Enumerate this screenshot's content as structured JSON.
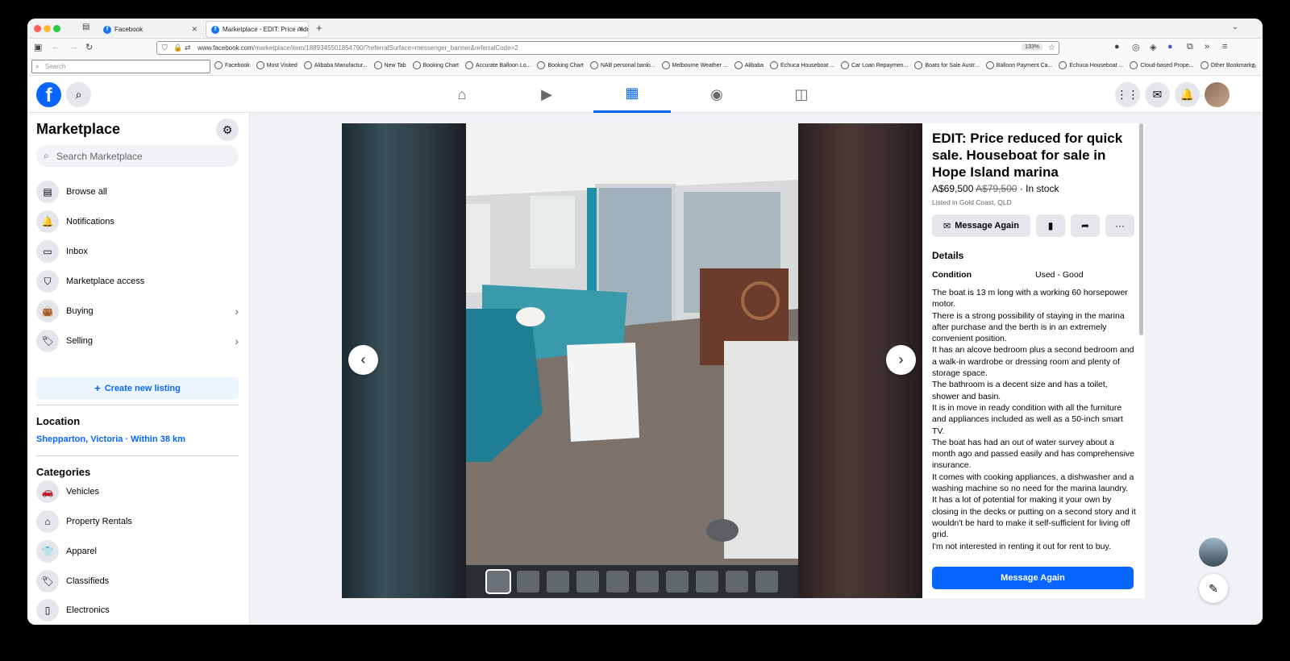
{
  "browser": {
    "tabs": [
      {
        "label": "Facebook"
      },
      {
        "label": "Marketplace - EDIT: Price reduc"
      }
    ],
    "url_host": "www.facebook.com",
    "url_path": "/marketplace/item/1889345501854790/?referralSurface=messenger_banner&referralCode=2",
    "zoom": "133%",
    "search_placeholder": "Search",
    "bookmarks": [
      "Facebook",
      "Most Visited",
      "Alibaba Manufactur...",
      "New Tab",
      "Booking Chart",
      "Accurate Balloon Lo...",
      "Booking Chart",
      "NAB personal banki...",
      "Melbourne Weather ...",
      "Alibaba",
      "Echuca Houseboat ...",
      "Car Loan Repaymen...",
      "Boats for Sale Austr...",
      "Balloon Payment Ca...",
      "Echuca Houseboat ...",
      "Cloud-based Prope...",
      "Other Bookmarks"
    ]
  },
  "sidebar": {
    "title": "Marketplace",
    "search_placeholder": "Search Marketplace",
    "items": [
      {
        "label": "Browse all",
        "icon": "store-icon"
      },
      {
        "label": "Notifications",
        "icon": "bell-icon"
      },
      {
        "label": "Inbox",
        "icon": "inbox-icon"
      },
      {
        "label": "Marketplace access",
        "icon": "shield-icon"
      },
      {
        "label": "Buying",
        "icon": "bag-icon"
      },
      {
        "label": "Selling",
        "icon": "tag-icon"
      }
    ],
    "create_label": "Create new listing",
    "location_heading": "Location",
    "location_value": "Shepparton, Victoria · Within 38 km",
    "categories_heading": "Categories",
    "categories": [
      {
        "label": "Vehicles",
        "icon": "car-icon"
      },
      {
        "label": "Property Rentals",
        "icon": "house-icon"
      },
      {
        "label": "Apparel",
        "icon": "shirt-icon"
      },
      {
        "label": "Classifieds",
        "icon": "tags-icon"
      },
      {
        "label": "Electronics",
        "icon": "phone-icon"
      }
    ]
  },
  "listing": {
    "title": "EDIT: Price reduced for quick sale. Houseboat for sale in Hope Island marina",
    "price": "A$69,500",
    "old_price": "A$79,500",
    "stock": "· In stock",
    "listed": "Listed in Gold Coast, QLD",
    "message_label": "Message Again",
    "details_heading": "Details",
    "condition_label": "Condition",
    "condition_value": "Used - Good",
    "description": [
      "The boat is 13 m long with a working 60 horsepower motor.",
      "There is a strong possibility of staying in the marina after purchase and the berth is in an extremely convenient position.",
      "It has an alcove bedroom plus a second bedroom and a walk-in wardrobe or dressing room and plenty of storage space.",
      "The bathroom is a decent size and has a toilet, shower and basin.",
      "It is in move in ready condition with all the furniture and appliances included as well as a 50-inch smart TV.",
      "The boat has had an out of water survey about a month ago and passed easily and has comprehensive insurance.",
      "It comes with cooking appliances, a dishwasher and a washing machine so no need for the marina laundry.",
      "It has a lot of potential for making it your own by closing in the decks or putting on a second story and it wouldn't be hard to make it self-sufficient for living off grid.",
      "I'm not interested in renting it out for rent to buy."
    ],
    "bottom_button": "Message Again",
    "thumbnail_count": 10,
    "selected_thumbnail": 1
  },
  "colors": {
    "brand": "#0866ff",
    "sidebar_bg": "#ffffff",
    "main_bg": "#f0f2f5"
  }
}
